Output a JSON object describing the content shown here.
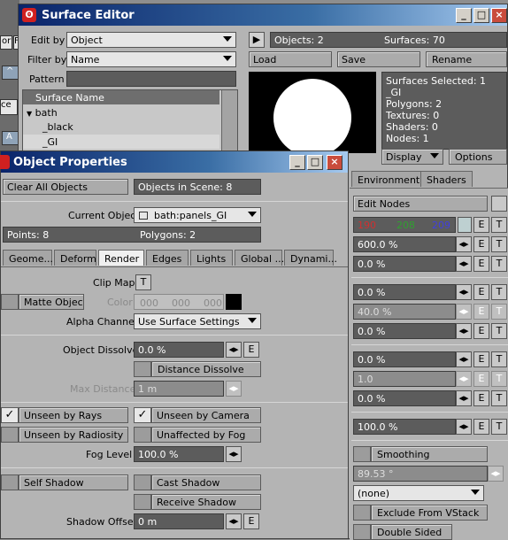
{
  "surface_editor": {
    "title": "Surface Editor",
    "edit_by_label": "Edit by",
    "edit_by_value": "Object",
    "filter_by_label": "Filter by",
    "filter_by_value": "Name",
    "pattern_label": "Pattern",
    "list_header": "Surface Name",
    "tree": [
      "bath",
      "_black",
      "_GI"
    ],
    "objects": "Objects: 2",
    "surfaces": "Surfaces: 70",
    "load": "Load",
    "save": "Save",
    "rename": "Rename",
    "info": [
      "Surfaces Selected: 1",
      "_GI",
      "Polygons: 2",
      "Textures: 0",
      "Shaders: 0",
      "Nodes: 1"
    ],
    "display": "Display",
    "options": "Options",
    "tabs": [
      "Environment",
      "Shaders"
    ],
    "edit_nodes": "Edit Nodes",
    "color_r": "190",
    "color_g": "208",
    "color_b": "209",
    "values": [
      "600.0 %",
      "0.0 %",
      "0.0 %",
      "40.0 %",
      "0.0 %",
      "0.0 %",
      "1.0",
      "0.0 %",
      "100.0 %"
    ],
    "smoothing": "Smoothing",
    "smoothing_angle": "89.53 °",
    "none_option": "(none)",
    "exclude_vstack": "Exclude From VStack",
    "double_sided": "Double Sided",
    "e": "E",
    "t": "T"
  },
  "left_strip": [
    "or",
    "F",
    "^",
    "ce",
    "A"
  ],
  "object_properties": {
    "title": "Object Properties",
    "clear_all": "Clear All Objects",
    "objects_in_scene": "Objects in Scene: 8",
    "current_object_label": "Current Object",
    "current_object_value": "bath:panels_GI",
    "points": "Points: 8",
    "polygons": "Polygons: 2",
    "tabs": [
      "Geome...",
      "Deform",
      "Render",
      "Edges",
      "Lights",
      "Global ...",
      "Dynami..."
    ],
    "clip_map_label": "Clip Map",
    "clip_map_t": "T",
    "matte_object": "Matte Object",
    "color_label": "Color",
    "color_vals": [
      "000",
      "000",
      "000"
    ],
    "alpha_channel_label": "Alpha Channel",
    "alpha_channel_value": "Use Surface Settings",
    "object_dissolve_label": "Object Dissolve",
    "object_dissolve_value": "0.0 %",
    "distance_dissolve": "Distance Dissolve",
    "max_distance_label": "Max Distance",
    "max_distance_value": "1 m",
    "unseen_rays": "Unseen by Rays",
    "unseen_camera": "Unseen by Camera",
    "unseen_radiosity": "Unseen by Radiosity",
    "unaffected_fog": "Unaffected by Fog",
    "fog_level_label": "Fog Level",
    "fog_level_value": "100.0 %",
    "self_shadow": "Self Shadow",
    "cast_shadow": "Cast Shadow",
    "receive_shadow": "Receive Shadow",
    "shadow_offset_label": "Shadow Offset",
    "shadow_offset_value": "0 m",
    "e": "E",
    "check": "✓"
  },
  "colors": {
    "red": "#c00000",
    "green": "#008000",
    "blue": "#0000c0",
    "title_start": "#0a246a",
    "title_end": "#a6caf0"
  }
}
